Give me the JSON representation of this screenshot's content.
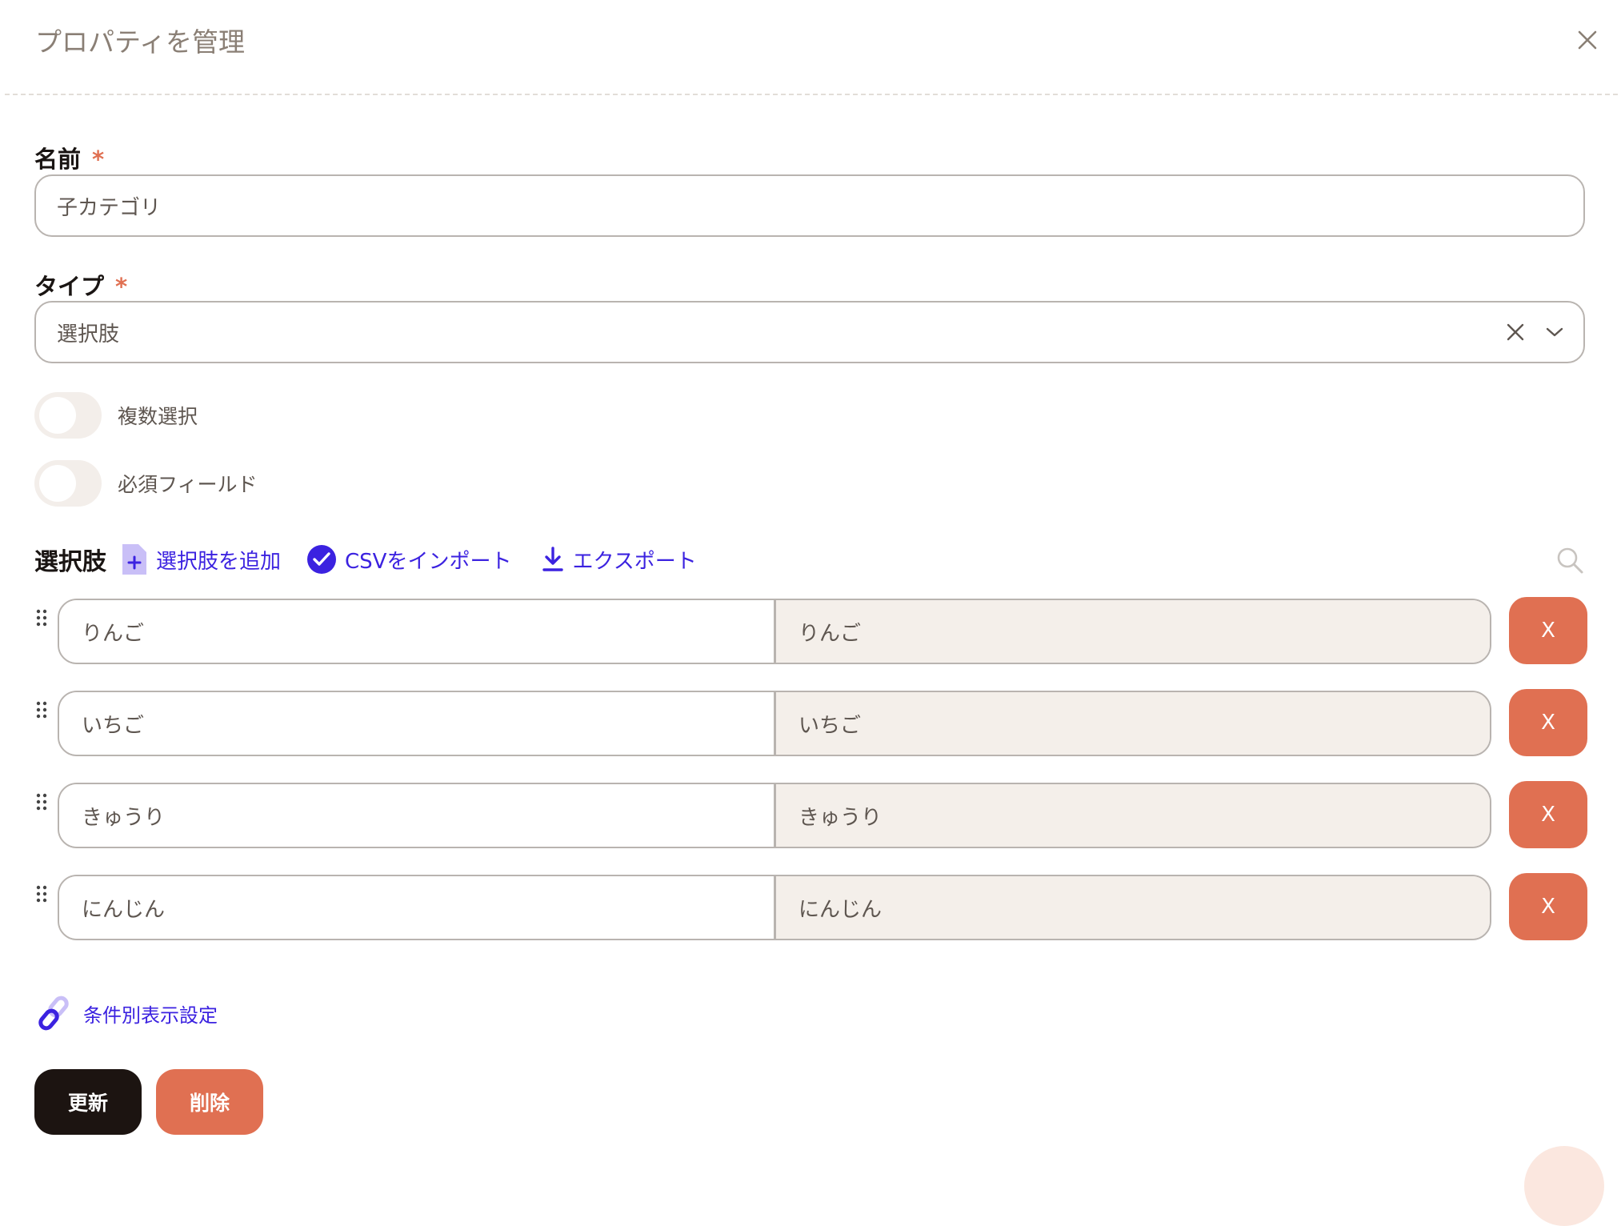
{
  "dialog": {
    "title": "プロパティを管理",
    "close_icon": "close-icon"
  },
  "name_field": {
    "label": "名前",
    "required_mark": "*",
    "value": "子カテゴリ"
  },
  "type_field": {
    "label": "タイプ",
    "required_mark": "*",
    "value": "選択肢"
  },
  "toggles": {
    "multi_select": {
      "label": "複数選択",
      "on": false
    },
    "required_field": {
      "label": "必須フィールド",
      "on": false
    }
  },
  "options_section": {
    "label": "選択肢",
    "add_label": "選択肢を追加",
    "import_label": "CSVをインポート",
    "export_label": "エクスポート",
    "items": [
      {
        "name": "りんご",
        "value": "りんご",
        "delete_label": "X"
      },
      {
        "name": "いちご",
        "value": "いちご",
        "delete_label": "X"
      },
      {
        "name": "きゅうり",
        "value": "きゅうり",
        "delete_label": "X"
      },
      {
        "name": "にんじん",
        "value": "にんじん",
        "delete_label": "X"
      }
    ]
  },
  "conditional_display": {
    "label": "条件別表示設定"
  },
  "actions": {
    "update_label": "更新",
    "delete_label": "削除"
  },
  "colors": {
    "accent": "#3b22e0",
    "danger": "#e07052",
    "primary_dark": "#1c1411",
    "readonly_bg": "#f4efea"
  }
}
